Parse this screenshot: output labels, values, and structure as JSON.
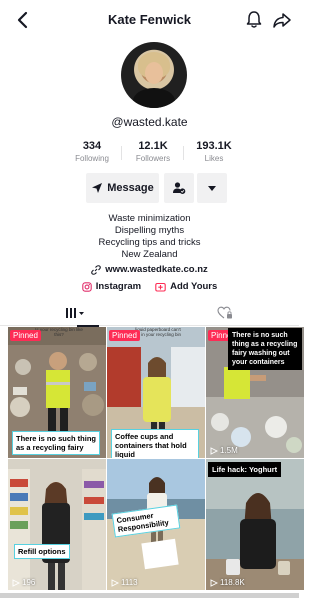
{
  "header": {
    "title": "Kate Fenwick",
    "back_icon": "chevron-left-icon",
    "bell_icon": "bell-icon",
    "share_icon": "share-arrow-icon"
  },
  "profile": {
    "username": "@wasted.kate",
    "stats": [
      {
        "value": "334",
        "label": "Following"
      },
      {
        "value": "12.1K",
        "label": "Followers"
      },
      {
        "value": "193.1K",
        "label": "Likes"
      }
    ],
    "message_label": "Message",
    "bio_lines": [
      "Waste minimization",
      "Dispelling myths",
      "Recycling tips and tricks",
      "New Zealand"
    ],
    "link": "www.wastedkate.co.nz",
    "instagram_label": "Instagram",
    "youtube_label": "Add Yours"
  },
  "tabs": {
    "videos_icon": "grid-icon",
    "liked_icon": "heart-lock-icon"
  },
  "videos": [
    {
      "pinned": "Pinned",
      "caption": "There is no such thing as a recycling fairy",
      "views": "",
      "top_text": "Is your recycling bin like this?"
    },
    {
      "pinned": "Pinned",
      "caption": "Coffee cups and containers that hold liquid",
      "views": "",
      "top_text": "liquid paperboard can't go in your recycling bin"
    },
    {
      "pinned": "Pinned",
      "caption": "There is no such thing as a recycling fairy washing out your containers",
      "views": "1.5M",
      "top_text": ""
    },
    {
      "pinned": "",
      "caption": "Refill options",
      "views": "196",
      "top_text": ""
    },
    {
      "pinned": "",
      "caption": "Consumer Responsibility",
      "views": "1113",
      "top_text": ""
    },
    {
      "pinned": "",
      "caption": "Life hack: Yoghurt",
      "views": "118.8K",
      "top_text": ""
    }
  ],
  "colors": {
    "accent": "#fe2c55",
    "caption_border": "#58d1e0",
    "button_bg": "#f1f1f2",
    "text": "#161823",
    "muted": "#8a8b91"
  }
}
